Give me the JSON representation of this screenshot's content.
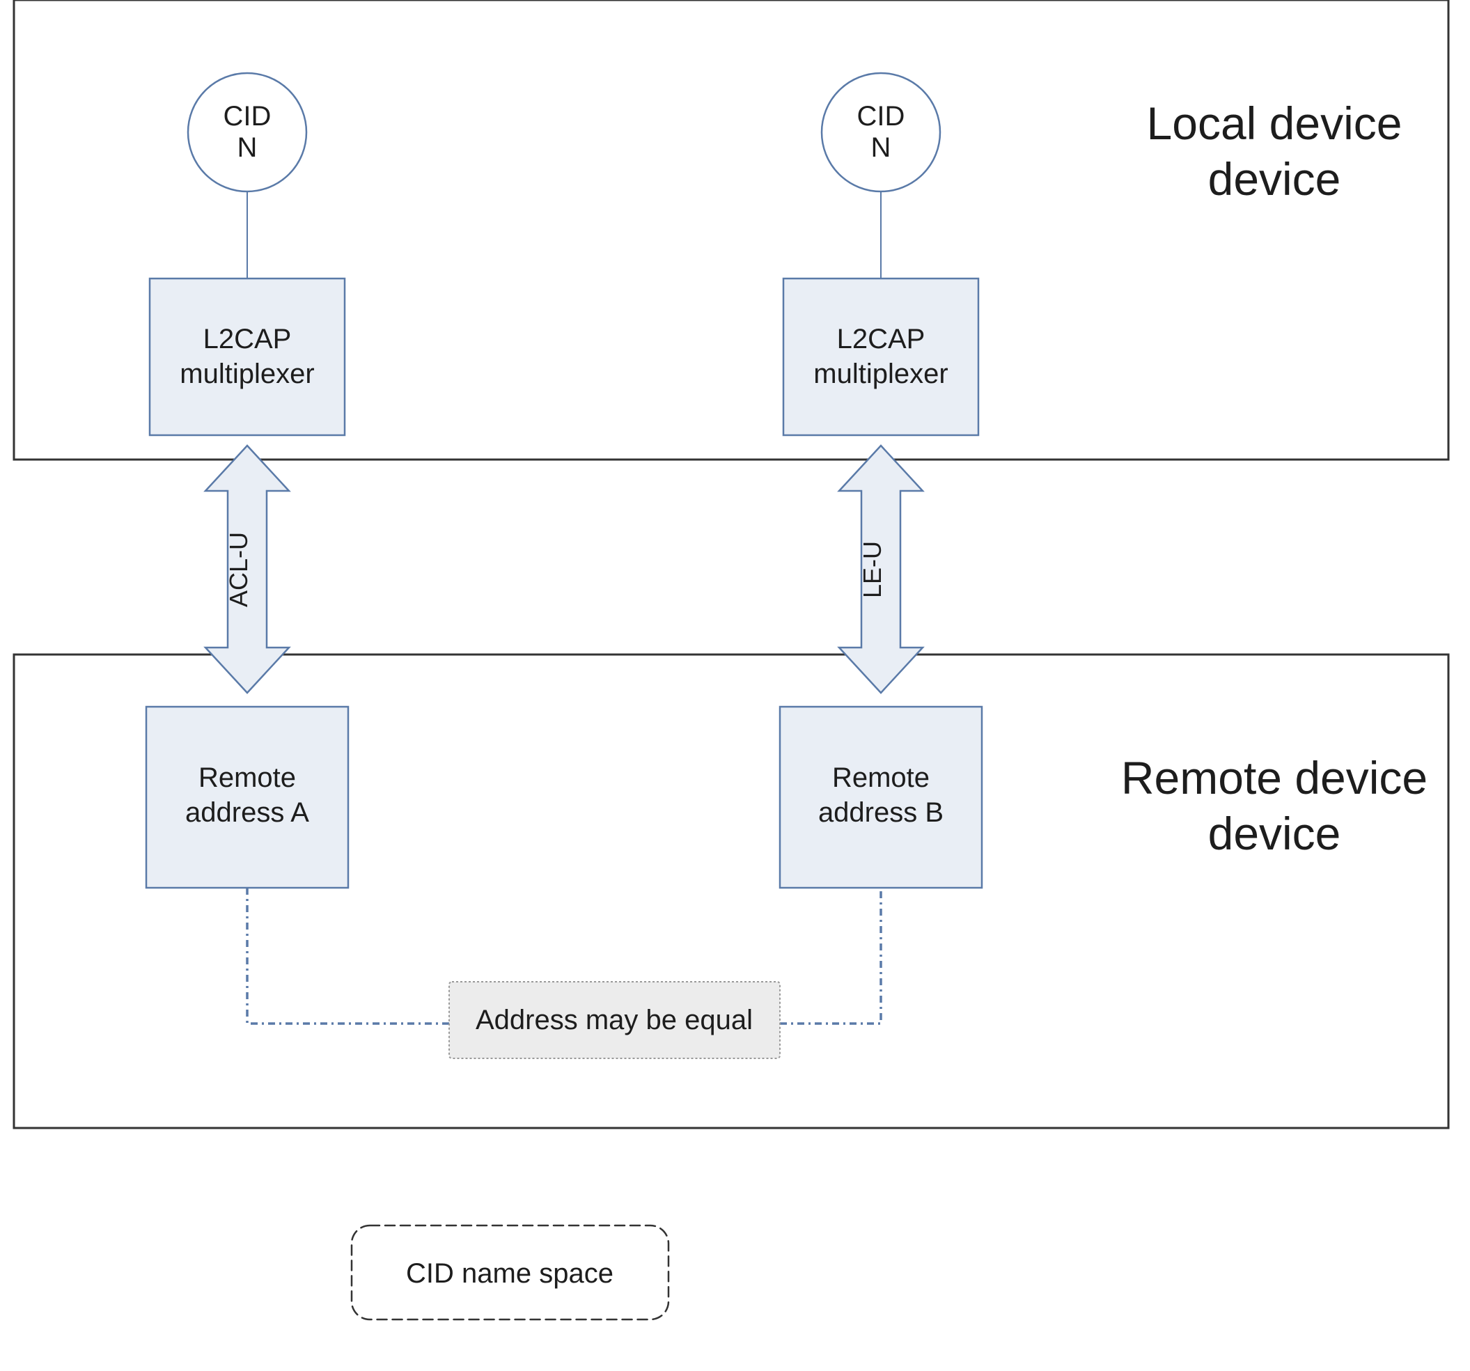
{
  "labels": {
    "local_device": "Local device",
    "remote_device": "Remote device"
  },
  "local": {
    "cid_left": {
      "line1": "CID",
      "line2": "N"
    },
    "cid_right": {
      "line1": "CID",
      "line2": "N"
    },
    "mux_left": {
      "line1": "L2CAP",
      "line2": "multiplexer"
    },
    "mux_right": {
      "line1": "L2CAP",
      "line2": "multiplexer"
    }
  },
  "links": {
    "left": "ACL-U",
    "right": "LE-U"
  },
  "remote": {
    "addr_left": {
      "line1": "Remote",
      "line2": "address A"
    },
    "addr_right": {
      "line1": "Remote",
      "line2": "address B"
    },
    "equality": "Address may be equal"
  },
  "legend": {
    "cid_space": "CID name space"
  }
}
